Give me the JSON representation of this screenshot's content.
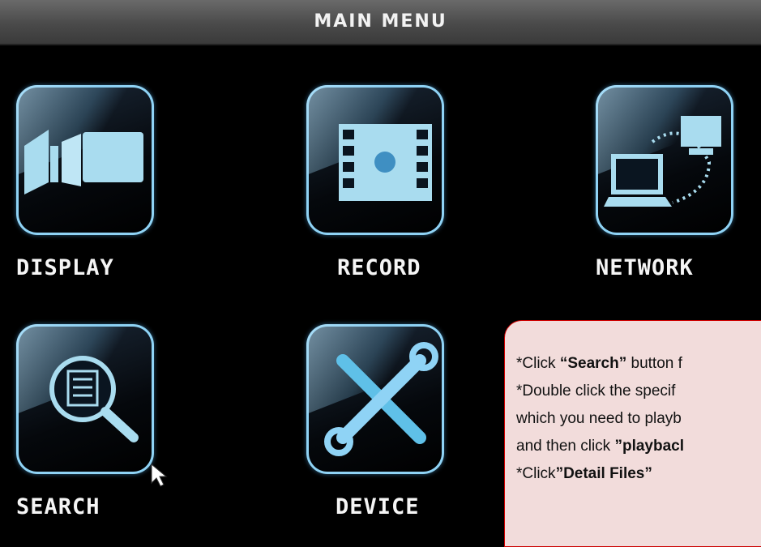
{
  "window": {
    "title": "MAIN MENU"
  },
  "menu": {
    "items": [
      {
        "label": "DISPLAY",
        "icon": "display-icon"
      },
      {
        "label": "RECORD",
        "icon": "film-strip-icon"
      },
      {
        "label": "NETWORK",
        "icon": "network-icon"
      },
      {
        "label": "SEARCH",
        "icon": "search-icon"
      },
      {
        "label": "DEVICE",
        "icon": "tools-icon"
      }
    ]
  },
  "note": {
    "line1_prefix": "*Click ",
    "line1_bold": "“Search”",
    "line1_suffix": " button f",
    "line2": "*Double click the specif",
    "line3": "which you need to playb",
    "line4_prefix": "and then click ",
    "line4_bold": "”playbacl",
    "line5_prefix": "*Click",
    "line5_bold": "”Detail Files”"
  },
  "colors": {
    "accent": "#8fd3f5",
    "icon_fill": "#a9dcef",
    "note_bg": "#f2dcdb",
    "note_border": "#cc0000"
  }
}
